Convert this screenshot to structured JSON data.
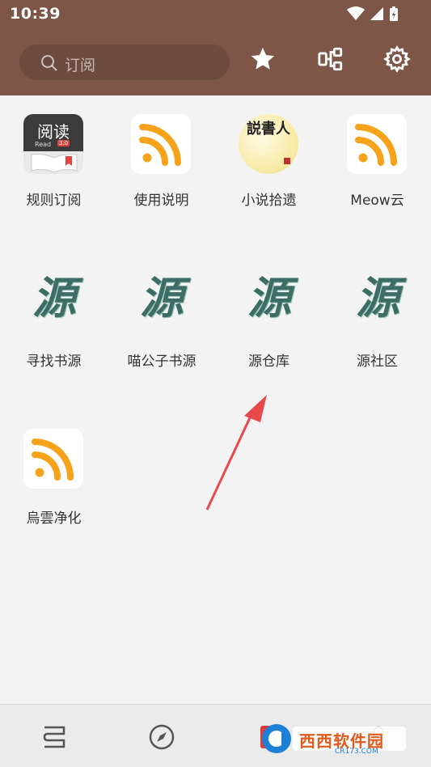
{
  "status": {
    "time": "10:39"
  },
  "header": {
    "search_placeholder": "订阅",
    "background": "#7d5647"
  },
  "items": [
    {
      "label": "规则订阅",
      "icon": "read-app-icon"
    },
    {
      "label": "使用说明",
      "icon": "rss-icon"
    },
    {
      "label": "小说拾遗",
      "icon": "novel-seal-icon"
    },
    {
      "label": "Meow云",
      "icon": "rss-icon"
    },
    {
      "label": "寻找书源",
      "icon": "yuan-calligraphy-icon"
    },
    {
      "label": "喵公子书源",
      "icon": "yuan-calligraphy-icon"
    },
    {
      "label": "源仓库",
      "icon": "yuan-calligraphy-icon"
    },
    {
      "label": "源社区",
      "icon": "yuan-calligraphy-icon"
    },
    {
      "label": "烏雲净化",
      "icon": "rss-icon"
    }
  ],
  "read_icon_text": {
    "title": "阅读",
    "sub": "Read",
    "version": "3.0"
  },
  "seal_text": "説書人",
  "yuan_char": "源",
  "bottom_nav": [
    "bookshelf-icon",
    "discover-icon",
    "rss-icon",
    "profile-icon"
  ],
  "watermark": {
    "text": "西西软件园",
    "sub": "CR173.COM"
  },
  "colors": {
    "accent": "#f7a21b",
    "arrow": "#e8494b"
  }
}
